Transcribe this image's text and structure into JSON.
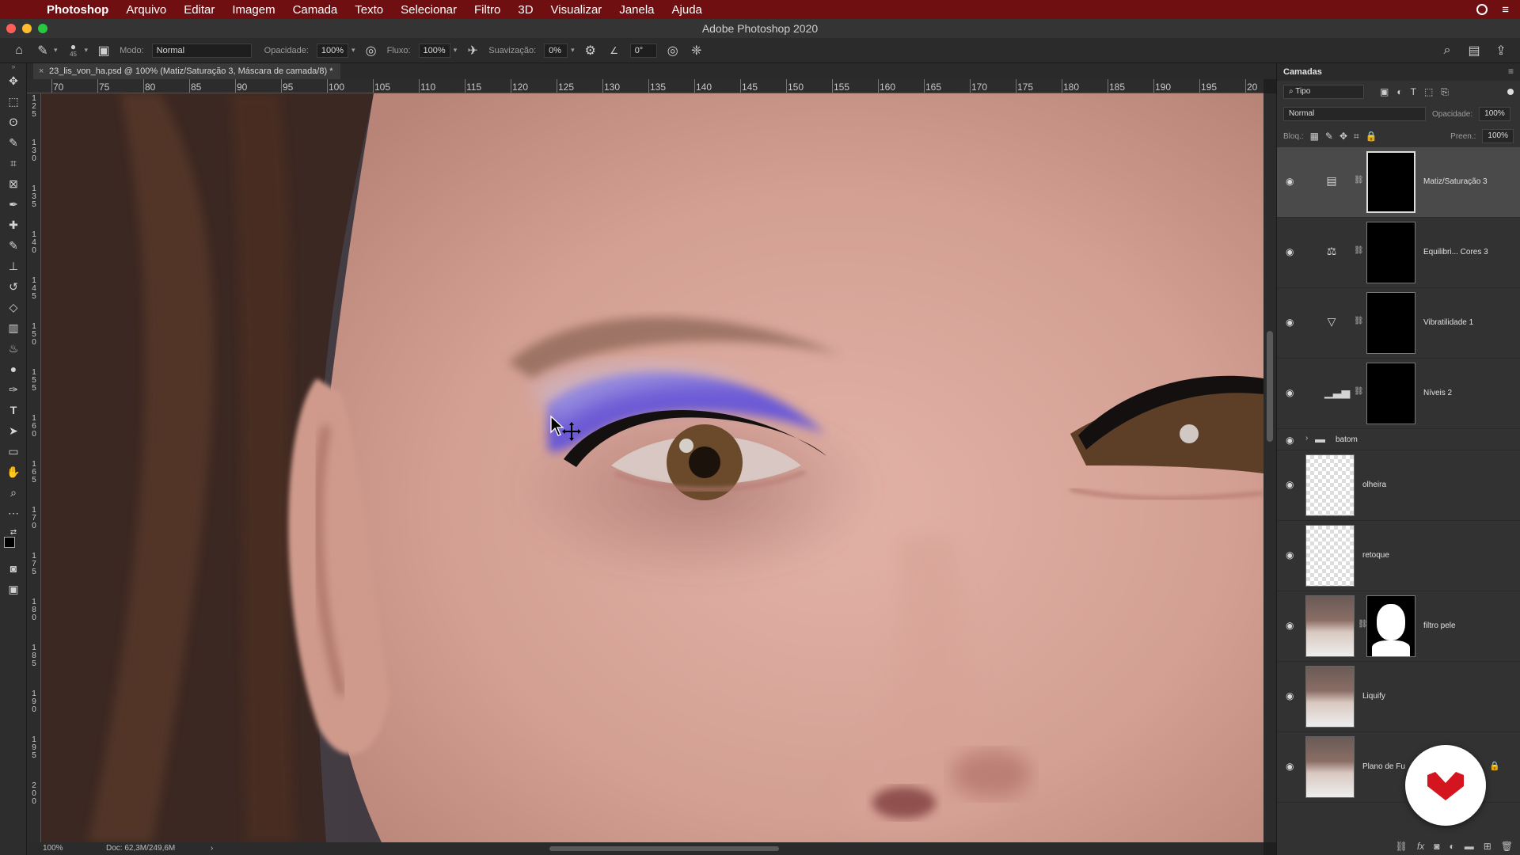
{
  "menubar": {
    "app": "Photoshop",
    "items": [
      "Arquivo",
      "Editar",
      "Imagem",
      "Camada",
      "Texto",
      "Selecionar",
      "Filtro",
      "3D",
      "Visualizar",
      "Janela",
      "Ajuda"
    ]
  },
  "window": {
    "title": "Adobe Photoshop 2020"
  },
  "options": {
    "brush_size": "45",
    "mode_label": "Modo:",
    "mode_value": "Normal",
    "opacity_label": "Opacidade:",
    "opacity_value": "100%",
    "flow_label": "Fluxo:",
    "flow_value": "100%",
    "smoothing_label": "Suavização:",
    "smoothing_value": "0%",
    "angle_value": "0°"
  },
  "document": {
    "tab_title": "23_lis_von_ha.psd @ 100% (Matiz/Saturação 3, Máscara de camada/8) *"
  },
  "ruler": {
    "top_ticks": [
      "70",
      "75",
      "80",
      "85",
      "90",
      "95",
      "100",
      "105",
      "110",
      "115",
      "120",
      "125",
      "130",
      "135",
      "140",
      "145",
      "150",
      "155",
      "160",
      "165",
      "170",
      "175",
      "180",
      "185",
      "190",
      "195",
      "20"
    ],
    "left_ticks": [
      "125",
      "130",
      "135",
      "140",
      "145",
      "150",
      "155",
      "160",
      "165",
      "170",
      "175",
      "180",
      "185",
      "190",
      "195",
      "200"
    ]
  },
  "status": {
    "zoom": "100%",
    "doc_info": "Doc: 62,3M/249,6M",
    "arrow": "›"
  },
  "layers_panel": {
    "title": "Camadas",
    "filter_value": "Tipo",
    "blend_mode": "Normal",
    "opacity_label": "Opacidade:",
    "opacity_value": "100%",
    "lock_label": "Bloq.:",
    "fill_label": "Preen.:",
    "fill_value": "100%",
    "layers": [
      {
        "name": "Matiz/Saturação 3",
        "adjustment_icon": "hue-saturation-icon",
        "selected": true
      },
      {
        "name": "Equilibri... Cores 3",
        "adjustment_icon": "color-balance-icon",
        "selected": false
      },
      {
        "name": "Vibratilidade 1",
        "adjustment_icon": "vibrance-icon",
        "selected": false
      },
      {
        "name": "Níveis 2",
        "adjustment_icon": "levels-icon",
        "selected": false
      },
      {
        "name": "batom",
        "type": "group"
      },
      {
        "name": "olheira",
        "type": "pixel"
      },
      {
        "name": "retoque",
        "type": "pixel"
      },
      {
        "name": "filtro pele",
        "type": "pixel-masked"
      },
      {
        "name": "Liquify",
        "type": "pixel"
      },
      {
        "name": "Plano de Fu",
        "type": "background"
      }
    ]
  },
  "colors": {
    "menubar_bg": "#6f0f12",
    "eyeshadow": "#5a4de0",
    "badge_red": "#d4141e"
  }
}
